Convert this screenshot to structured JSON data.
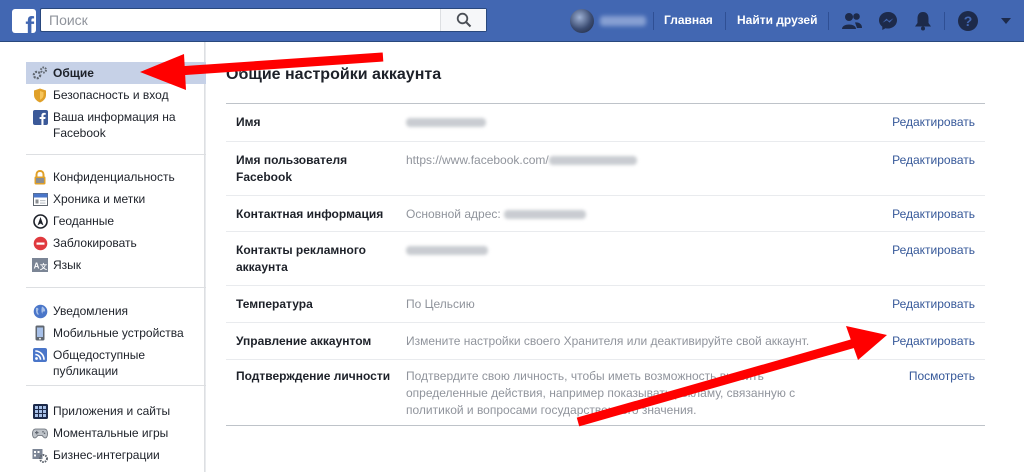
{
  "topbar": {
    "search_placeholder": "Поиск",
    "nav_home": "Главная",
    "nav_find_friends": "Найти друзей",
    "icons": [
      "facebook-logo-icon",
      "search-icon",
      "friends-icon",
      "messenger-icon",
      "bell-icon",
      "help-icon",
      "dropdown-caret-icon"
    ],
    "colors": {
      "bar": "#4267b2",
      "active_menu": "#c6d1e7",
      "link": "#365899",
      "arrow": "#ff0000"
    }
  },
  "sidebar": {
    "group1": [
      {
        "label": "Общие",
        "icon": "gears-icon",
        "active": true
      },
      {
        "label": "Безопасность и вход",
        "icon": "shield-icon"
      },
      {
        "label": "Ваша информация на Facebook",
        "icon": "facebook-square-icon"
      }
    ],
    "group2": [
      {
        "label": "Конфиденциальность",
        "icon": "lock-icon"
      },
      {
        "label": "Хроника и метки",
        "icon": "timeline-icon"
      },
      {
        "label": "Геоданные",
        "icon": "location-icon"
      },
      {
        "label": "Заблокировать",
        "icon": "block-icon"
      },
      {
        "label": "Язык",
        "icon": "language-icon"
      }
    ],
    "group3": [
      {
        "label": "Уведомления",
        "icon": "globe-icon"
      },
      {
        "label": "Мобильные устройства",
        "icon": "mobile-icon"
      },
      {
        "label": "Общедоступные публикации",
        "icon": "rss-icon"
      }
    ],
    "group4": [
      {
        "label": "Приложения и сайты",
        "icon": "apps-icon"
      },
      {
        "label": "Моментальные игры",
        "icon": "gamepad-icon"
      },
      {
        "label": "Бизнес-интеграции",
        "icon": "business-gear-icon"
      }
    ]
  },
  "main": {
    "title": "Общие настройки аккаунта",
    "rows": [
      {
        "label": "Имя",
        "value": "",
        "action": "Редактировать"
      },
      {
        "label": "Имя пользователя Facebook",
        "value": "https://www.facebook.com/",
        "action": "Редактировать"
      },
      {
        "label": "Контактная информация",
        "value": "Основной адрес:",
        "action": "Редактировать"
      },
      {
        "label": "Контакты рекламного аккаунта",
        "value": "",
        "action": "Редактировать"
      },
      {
        "label": "Температура",
        "value": "По Цельсию",
        "action": "Редактировать"
      },
      {
        "label": "Управление аккаунтом",
        "value": "Измените настройки своего Хранителя или деактивируйте свой аккаунт.",
        "action": "Редактировать"
      },
      {
        "label": "Подтверждение личности",
        "value": "Подтвердите свою личность, чтобы иметь возможность вносить определенные действия, например показывать рекламу, связанную с политикой и вопросами государственного значения.",
        "action": "Посмотреть"
      }
    ]
  }
}
